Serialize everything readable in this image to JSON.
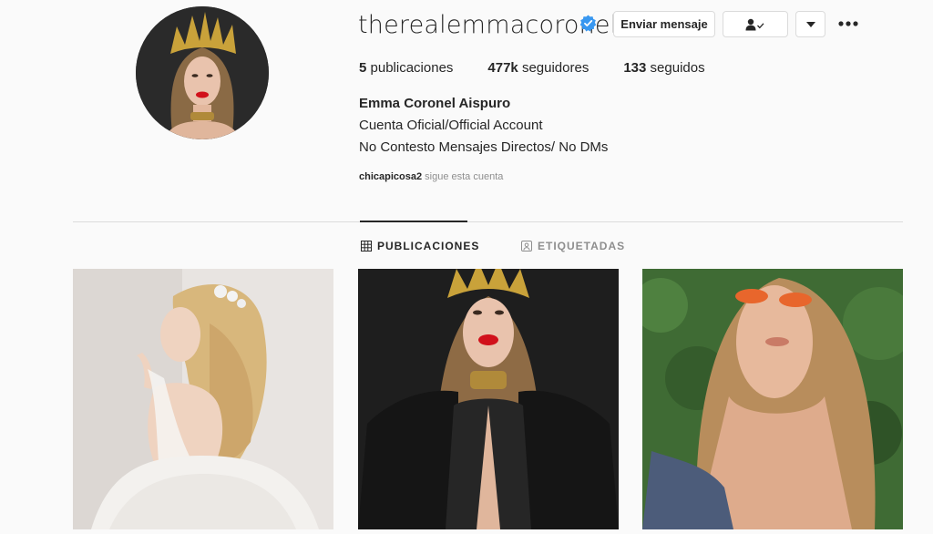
{
  "profile": {
    "username": "therealemmacoronel",
    "full_name": "Emma Coronel Aispuro",
    "bio_line1": "Cuenta Oficial/Official Account",
    "bio_line2": "No Contesto Mensajes Directos/ No DMs",
    "followed_by_user": "chicapicosa2",
    "followed_by_text": " sigue esta cuenta"
  },
  "stats": {
    "posts_count": "5",
    "posts_label": " publicaciones",
    "followers_count": "477k",
    "followers_label": " seguidores",
    "following_count": "133",
    "following_label": " seguidos"
  },
  "actions": {
    "message_label": "Enviar mensaje"
  },
  "tabs": [
    {
      "label": "PUBLICACIONES",
      "active": true
    },
    {
      "label": "ETIQUETADAS",
      "active": false
    }
  ],
  "icons": {
    "verified": "verified-badge-icon",
    "follow": "person-check-icon",
    "dropdown": "caret-down-icon",
    "more": "more-horizontal-icon",
    "grid": "grid-icon",
    "tagged": "tagged-person-icon"
  },
  "colors": {
    "verified_blue": "#3897f0",
    "text_primary": "#262626",
    "text_secondary": "#8e8e8e",
    "border": "#dbdbdb",
    "background": "#fafafa"
  }
}
